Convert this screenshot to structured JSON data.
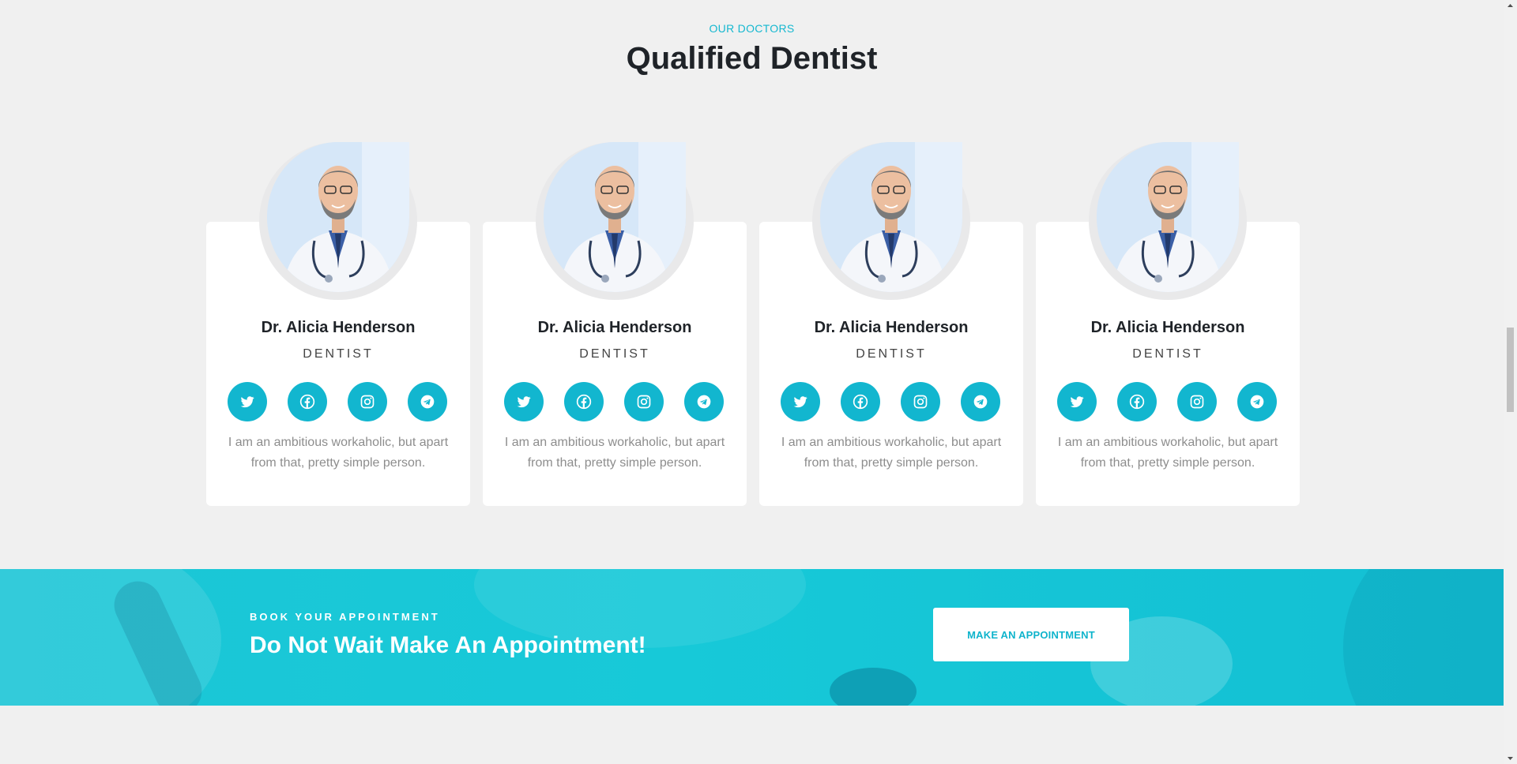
{
  "section": {
    "eyebrow": "OUR DOCTORS",
    "title": "Qualified Dentist"
  },
  "doctors": [
    {
      "name": "Dr. Alicia Henderson",
      "role": "DENTIST",
      "bio": "I am an ambitious workaholic, but apart from that, pretty simple person."
    },
    {
      "name": "Dr. Alicia Henderson",
      "role": "DENTIST",
      "bio": "I am an ambitious workaholic, but apart from that, pretty simple person."
    },
    {
      "name": "Dr. Alicia Henderson",
      "role": "DENTIST",
      "bio": "I am an ambitious workaholic, but apart from that, pretty simple person."
    },
    {
      "name": "Dr. Alicia Henderson",
      "role": "DENTIST",
      "bio": "I am an ambitious workaholic, but apart from that, pretty simple person."
    }
  ],
  "social_icons": [
    "twitter-icon",
    "facebook-icon",
    "instagram-icon",
    "telegram-icon"
  ],
  "banner": {
    "eyebrow": "BOOK YOUR APPOINTMENT",
    "title": "Do Not Wait Make An Appointment!",
    "button_label": "MAKE AN APPOINTMENT"
  },
  "colors": {
    "accent": "#12b6cf",
    "banner": "#17c9d8",
    "background": "#f0f0f0",
    "heading": "#1f2328"
  }
}
